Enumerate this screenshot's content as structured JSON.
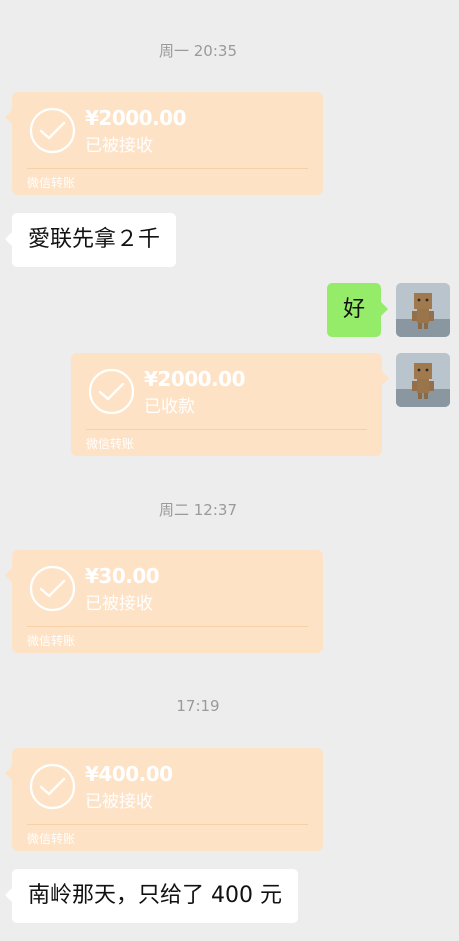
{
  "timestamps": [
    "周一 20:35",
    "周二 12:37",
    "17:19"
  ],
  "transfers": [
    {
      "amount": "¥2000.00",
      "status": "已被接收",
      "footer": "微信转账"
    },
    {
      "amount": "¥2000.00",
      "status": "已收款",
      "footer": "微信转账"
    },
    {
      "amount": "¥30.00",
      "status": "已被接收",
      "footer": "微信转账"
    },
    {
      "amount": "¥400.00",
      "status": "已被接收",
      "footer": "微信转账"
    }
  ],
  "messages": [
    {
      "text": "愛联先拿２千"
    },
    {
      "text": "好"
    },
    {
      "text": "南岭那天，只给了 400 元"
    }
  ],
  "colors": {
    "background": "#ededed",
    "transfer_card": "#fde2c6",
    "my_bubble": "#95ec69",
    "other_bubble": "#ffffff"
  },
  "icons": {
    "transfer": "check-circle-icon",
    "avatar": "cardboard-robot-avatar"
  }
}
